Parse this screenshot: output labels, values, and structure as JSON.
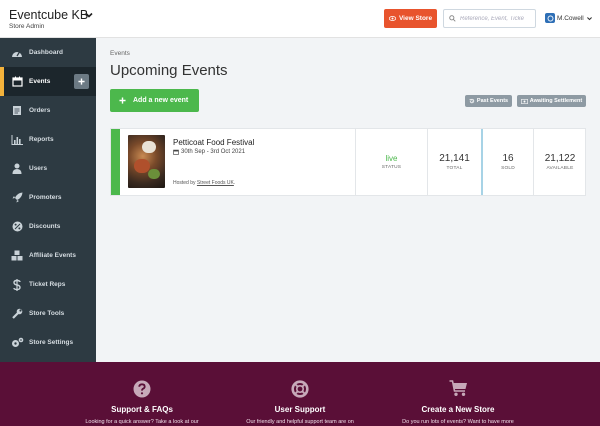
{
  "header": {
    "store_name": "Eventcube KB",
    "store_role": "Store Admin",
    "view_store_label": "View Store",
    "search_placeholder": "Reference, Event, Ticke",
    "user_name": "M.Cowell"
  },
  "sidebar": {
    "items": [
      {
        "label": "Dashboard",
        "icon": "dashboard-icon"
      },
      {
        "label": "Events",
        "icon": "calendar-icon",
        "active": true
      },
      {
        "label": "Orders",
        "icon": "orders-icon"
      },
      {
        "label": "Reports",
        "icon": "bar-chart-icon"
      },
      {
        "label": "Users",
        "icon": "user-icon"
      },
      {
        "label": "Promoters",
        "icon": "rocket-icon"
      },
      {
        "label": "Discounts",
        "icon": "discount-icon"
      },
      {
        "label": "Affiliate Events",
        "icon": "cubes-icon"
      },
      {
        "label": "Ticket Reps",
        "icon": "dollar-icon"
      },
      {
        "label": "Store Tools",
        "icon": "wrench-icon"
      },
      {
        "label": "Store Settings",
        "icon": "cogs-icon"
      }
    ]
  },
  "main": {
    "breadcrumb": "Events",
    "title": "Upcoming Events",
    "add_event_label": "Add a new event",
    "past_events_label": "Past Events",
    "awaiting_settlement_label": "Awaiting Settlement"
  },
  "event": {
    "title": "Petticoat Food Festival",
    "dates": "30th Sep - 3rd Oct 2021",
    "hosted_prefix": "Hosted by",
    "host": "Street Foods UK",
    "host_suffix": ".",
    "stats": [
      {
        "value": "live",
        "label": "STATUS"
      },
      {
        "value": "21,141",
        "label": "TOTAL"
      },
      {
        "value": "16",
        "label": "SOLD"
      },
      {
        "value": "21,122",
        "label": "AVAILABLE"
      }
    ]
  },
  "footer": {
    "columns": [
      {
        "title": "Support & FAQs",
        "text": "Looking for a quick answer? Take a look at our",
        "icon": "question-circle-icon"
      },
      {
        "title": "User Support",
        "text": "Our friendly and helpful support team are on",
        "icon": "life-ring-icon"
      },
      {
        "title": "Create a New Store",
        "text": "Do you run lots of events? Want to have more",
        "icon": "cart-icon"
      }
    ]
  },
  "colors": {
    "sidebar_bg": "#2d3a42",
    "active_accent": "#f3b23b",
    "primary_green": "#4cb84c",
    "view_store_orange": "#e8542d",
    "footer_bg": "#5a0f37"
  }
}
